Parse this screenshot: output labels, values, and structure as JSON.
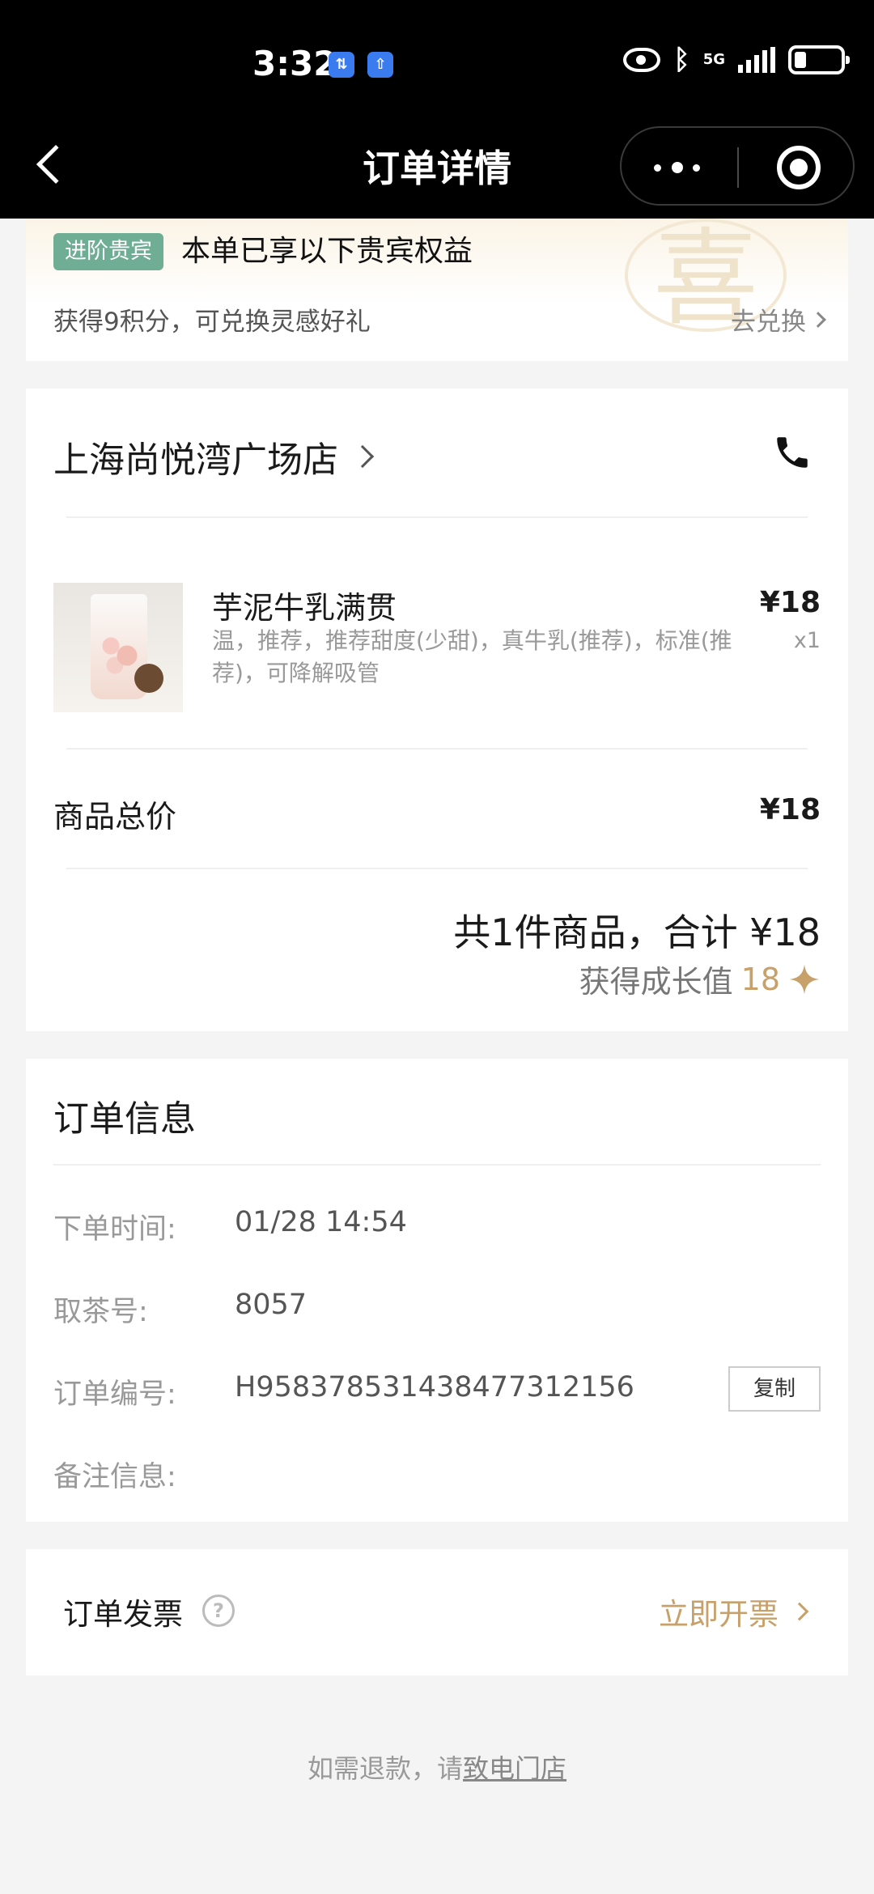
{
  "status_bar": {
    "time": "3:32",
    "badge1": "⇅",
    "badge2": "⇧",
    "network": "5G"
  },
  "nav": {
    "title": "订单详情"
  },
  "vip": {
    "badge": "进阶贵宾",
    "title": "本单已享以下贵宾权益",
    "points_text": "获得9积分，可兑换灵感好礼",
    "exchange_label": "去兑换",
    "deco_char": "喜"
  },
  "order": {
    "store_name": "上海尚悦湾广场店",
    "item": {
      "name": "芋泥牛乳满贯",
      "desc": "温，推荐，推荐甜度(少甜)，真牛乳(推荐)，标准(推荐)，可降解吸管",
      "price": "¥18",
      "qty": "x1"
    },
    "total_label": "商品总价",
    "total_value": "¥18",
    "summary": "共1件商品，合计 ¥18",
    "growth_label": "获得成长值",
    "growth_value": "18"
  },
  "info": {
    "title": "订单信息",
    "order_time_label": "下单时间:",
    "order_time": "01/28 14:54",
    "pickup_label": "取茶号:",
    "pickup_number": "8057",
    "order_no_label": "订单编号:",
    "order_no": "H95837853143847731215 6",
    "copy_label": "复制",
    "remark_label": "备注信息:"
  },
  "invoice": {
    "label": "订单发票",
    "help": "?",
    "action": "立即开票"
  },
  "refund": {
    "prefix": "如需退款，请",
    "link": "致电门店"
  },
  "colors": {
    "accent_gold": "#c7a06a",
    "vip_green": "#6fae95"
  }
}
